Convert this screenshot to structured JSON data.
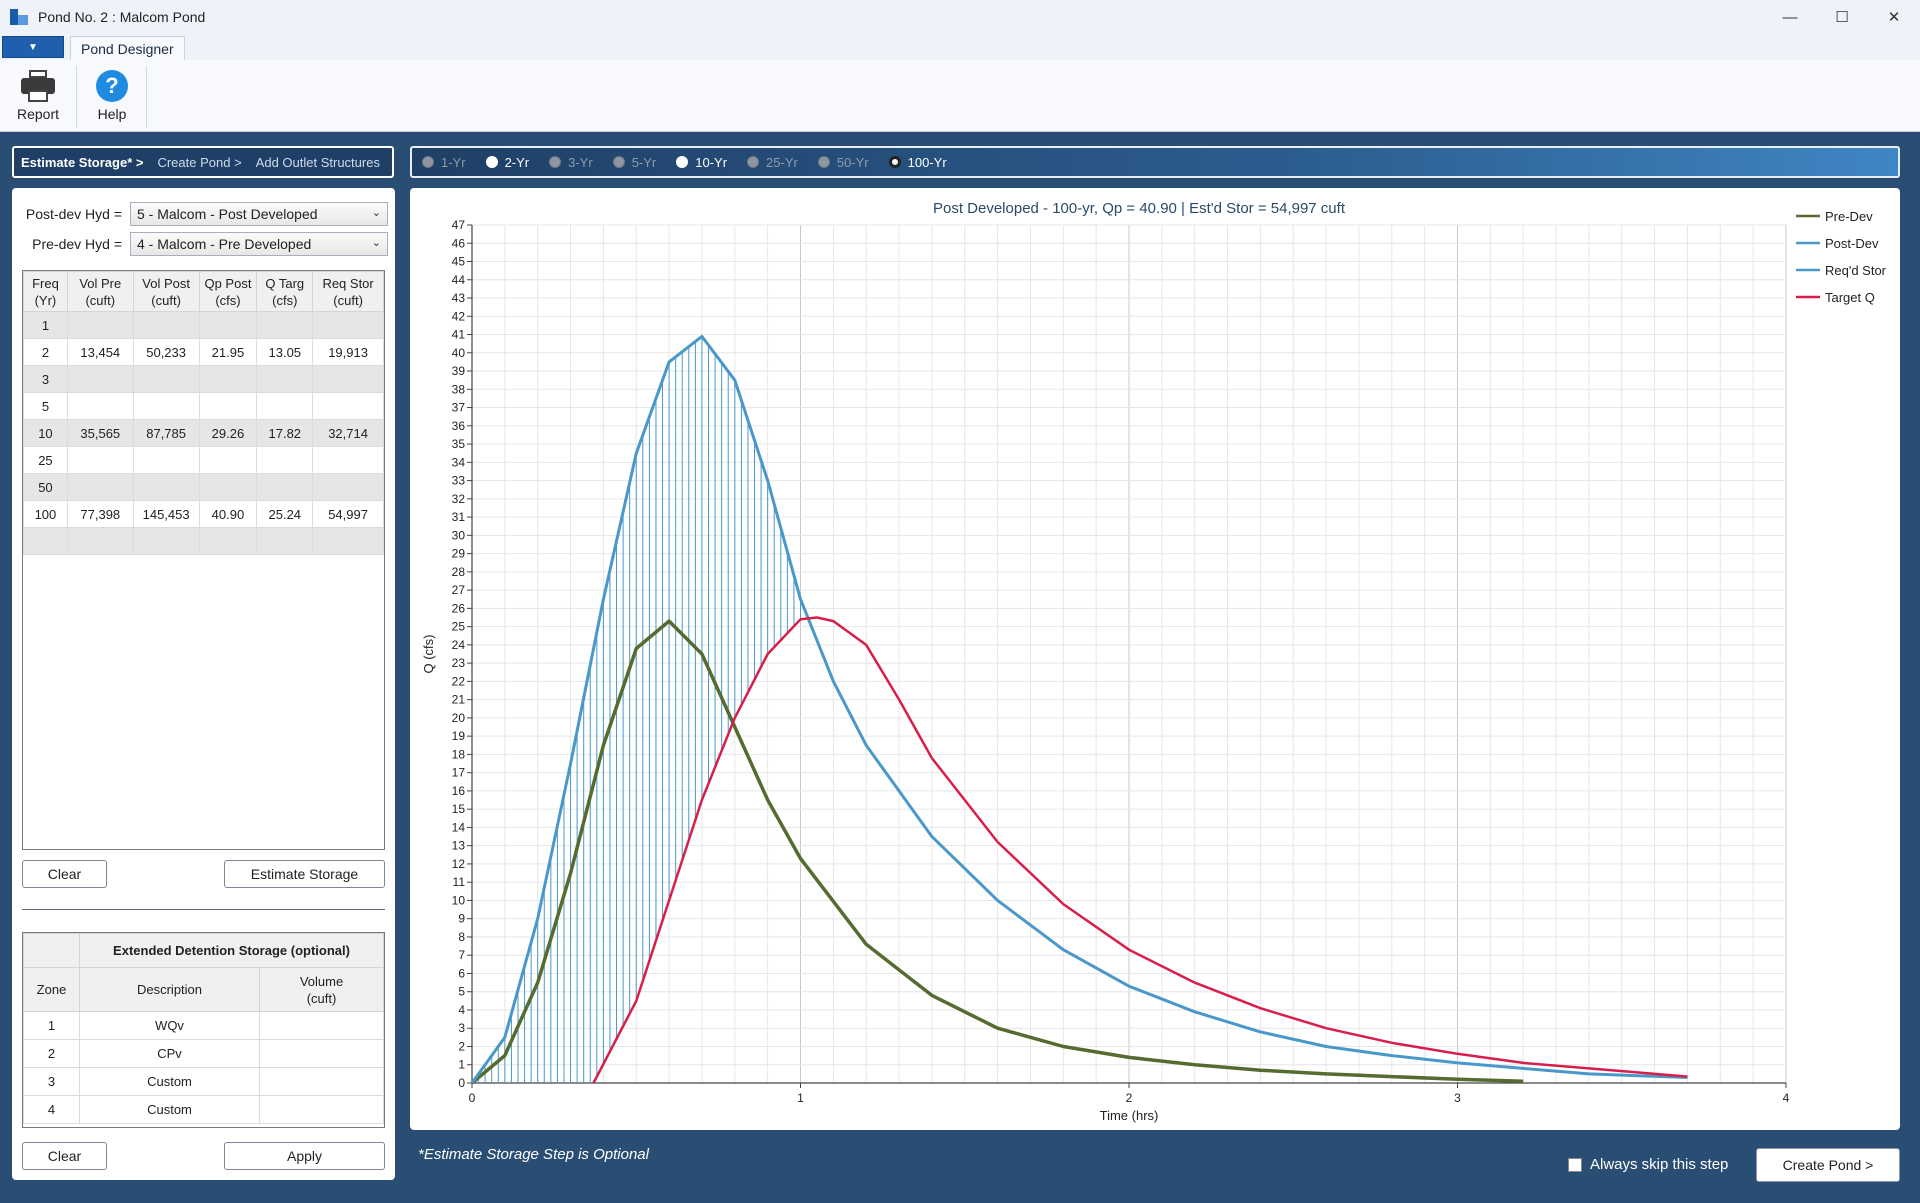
{
  "window": {
    "title": "Pond No. 2 : Malcom Pond",
    "minimize": "—",
    "maximize": "☐",
    "close": "✕"
  },
  "ribbon": {
    "file_glyph": "▼",
    "tab": "Pond Designer",
    "report_label": "Report",
    "help_label": "Help",
    "help_glyph": "?"
  },
  "steps": [
    "Estimate Storage* >",
    "Create Pond >",
    "Add Outlet Structures"
  ],
  "frequencies": [
    {
      "label": "1-Yr",
      "state": "off"
    },
    {
      "label": "2-Yr",
      "state": "on"
    },
    {
      "label": "3-Yr",
      "state": "off"
    },
    {
      "label": "5-Yr",
      "state": "off"
    },
    {
      "label": "10-Yr",
      "state": "on"
    },
    {
      "label": "25-Yr",
      "state": "off"
    },
    {
      "label": "50-Yr",
      "state": "off"
    },
    {
      "label": "100-Yr",
      "state": "selected"
    }
  ],
  "hyd": {
    "post_label": "Post-dev Hyd =",
    "post_value": "5 - Malcom - Post Developed",
    "pre_label": "Pre-dev Hyd =",
    "pre_value": "4 - Malcom - Pre Developed",
    "chevron": "⌄"
  },
  "storage_table": {
    "headers": [
      [
        "Freq",
        "(Yr)"
      ],
      [
        "Vol Pre",
        "(cuft)"
      ],
      [
        "Vol Post",
        "(cuft)"
      ],
      [
        "Qp Post",
        "(cfs)"
      ],
      [
        "Q Targ",
        "(cfs)"
      ],
      [
        "Req Stor",
        "(cuft)"
      ]
    ],
    "rows": [
      [
        "1",
        "",
        "",
        "",
        "",
        ""
      ],
      [
        "2",
        "13,454",
        "50,233",
        "21.95",
        "13.05",
        "19,913"
      ],
      [
        "3",
        "",
        "",
        "",
        "",
        ""
      ],
      [
        "5",
        "",
        "",
        "",
        "",
        ""
      ],
      [
        "10",
        "35,565",
        "87,785",
        "29.26",
        "17.82",
        "32,714"
      ],
      [
        "25",
        "",
        "",
        "",
        "",
        ""
      ],
      [
        "50",
        "",
        "",
        "",
        "",
        ""
      ],
      [
        "100",
        "77,398",
        "145,453",
        "40.90",
        "25.24",
        "54,997"
      ],
      [
        "",
        "",
        "",
        "",
        "",
        ""
      ]
    ]
  },
  "buttons": {
    "clear": "Clear",
    "estimate": "Estimate Storage",
    "clear2": "Clear",
    "apply": "Apply",
    "create_pond": "Create Pond >"
  },
  "ed_table": {
    "title": "Extended Detention Storage (optional)",
    "headers": [
      "Zone",
      "Description",
      [
        "Volume",
        "(cuft)"
      ]
    ],
    "rows": [
      [
        "1",
        "WQv",
        ""
      ],
      [
        "2",
        "CPv",
        ""
      ],
      [
        "3",
        "Custom",
        ""
      ],
      [
        "4",
        "Custom",
        ""
      ]
    ]
  },
  "note": "*Estimate Storage Step is Optional",
  "skip_label": "Always skip this step",
  "colors": {
    "pre_dev": "#556b2f",
    "post_dev": "#4a98c9",
    "reqd_stor": "#4a98c9",
    "target_q": "#d81e4a",
    "accent": "#1f3f66"
  },
  "chart_data": {
    "type": "line",
    "title": "Post Developed - 100-yr, Qp = 40.90 | Est'd Stor = 54,997 cuft",
    "xlabel": "Time (hrs)",
    "ylabel": "Q (cfs)",
    "xlim": [
      0,
      4
    ],
    "ylim": [
      0,
      47
    ],
    "x_ticks": [
      0,
      1,
      2,
      3,
      4
    ],
    "y_ticks": [
      0,
      1,
      2,
      3,
      4,
      5,
      6,
      7,
      8,
      9,
      10,
      11,
      12,
      13,
      14,
      15,
      16,
      17,
      18,
      19,
      20,
      21,
      22,
      23,
      24,
      25,
      26,
      27,
      28,
      29,
      30,
      31,
      32,
      33,
      34,
      35,
      36,
      37,
      38,
      39,
      40,
      41,
      42,
      43,
      44,
      45,
      46,
      47
    ],
    "grid": true,
    "legend": "top-right",
    "series": [
      {
        "name": "Pre-Dev",
        "color": "#556b2f",
        "x": [
          0,
          0.1,
          0.2,
          0.3,
          0.4,
          0.5,
          0.6,
          0.7,
          0.8,
          0.9,
          1.0,
          1.2,
          1.4,
          1.6,
          1.8,
          2.0,
          2.2,
          2.4,
          2.6,
          2.8,
          3.0,
          3.2
        ],
        "y": [
          0,
          1.5,
          5.5,
          11.5,
          18.5,
          23.8,
          25.3,
          23.5,
          19.5,
          15.5,
          12.3,
          7.6,
          4.8,
          3.0,
          2.0,
          1.4,
          1.0,
          0.7,
          0.5,
          0.35,
          0.2,
          0.1
        ]
      },
      {
        "name": "Post-Dev",
        "color": "#4a98c9",
        "x": [
          0,
          0.1,
          0.2,
          0.3,
          0.4,
          0.5,
          0.6,
          0.7,
          0.8,
          0.9,
          1.0,
          1.1,
          1.2,
          1.4,
          1.6,
          1.8,
          2.0,
          2.2,
          2.4,
          2.6,
          2.8,
          3.0,
          3.2,
          3.4,
          3.7
        ],
        "y": [
          0,
          2.5,
          9,
          17.5,
          26.5,
          34.5,
          39.5,
          40.9,
          38.5,
          33,
          26.5,
          22,
          18.5,
          13.5,
          10,
          7.3,
          5.3,
          3.9,
          2.8,
          2.0,
          1.5,
          1.1,
          0.8,
          0.5,
          0.3
        ]
      },
      {
        "name": "Req'd Stor",
        "color": "#4a98c9"
      },
      {
        "name": "Target Q",
        "color": "#d81e4a",
        "x": [
          0.37,
          0.5,
          0.6,
          0.7,
          0.8,
          0.9,
          1.0,
          1.05,
          1.1,
          1.2,
          1.3,
          1.4,
          1.6,
          1.8,
          2.0,
          2.2,
          2.4,
          2.6,
          2.8,
          3.0,
          3.2,
          3.4,
          3.7
        ],
        "y": [
          0,
          4.5,
          10,
          15.5,
          20,
          23.5,
          25.4,
          25.5,
          25.3,
          24,
          21,
          17.8,
          13.2,
          9.8,
          7.3,
          5.5,
          4.1,
          3.0,
          2.2,
          1.6,
          1.1,
          0.8,
          0.35
        ]
      }
    ]
  }
}
